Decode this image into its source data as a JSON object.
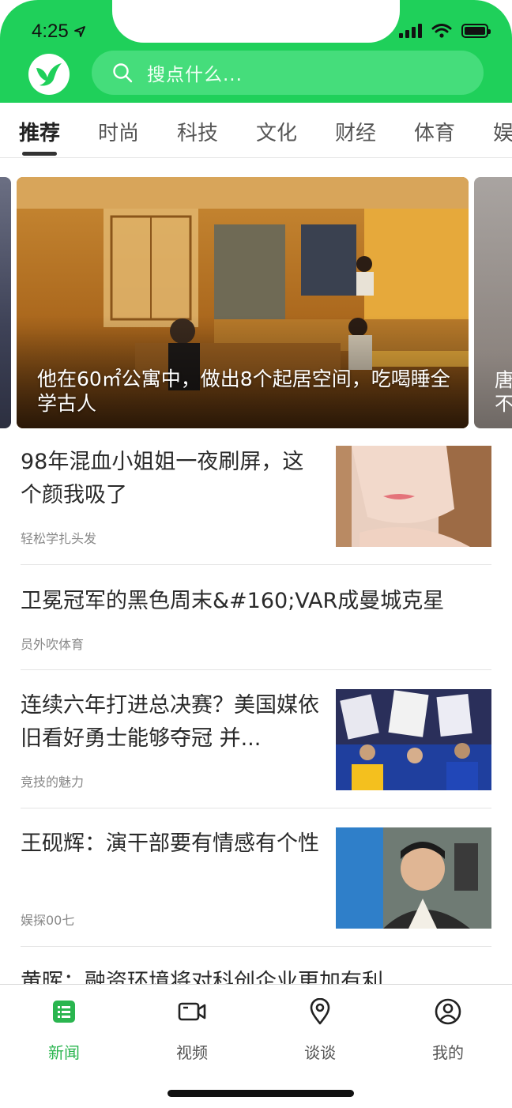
{
  "status_bar": {
    "time": "4:25"
  },
  "search": {
    "placeholder": "搜点什么..."
  },
  "tabs": [
    {
      "label": "推荐",
      "active": true
    },
    {
      "label": "时尚"
    },
    {
      "label": "科技"
    },
    {
      "label": "文化"
    },
    {
      "label": "财经"
    },
    {
      "label": "体育"
    },
    {
      "label": "娱"
    }
  ],
  "banner": {
    "caption": "他在60㎡公寓中，做出8个起居空间，吃喝睡全学古人",
    "next_caption_partial": "唐\n不"
  },
  "news": [
    {
      "title": "98年混血小姐姐一夜刷屏，这个颜我吸了",
      "source": "轻松学扎头发",
      "thumb": "portrait-woman"
    },
    {
      "title": "卫冕冠军的黑色周末&#160;VAR成曼城克星",
      "source": "员外吹体育"
    },
    {
      "title": "连续六年打进总决赛？美国媒依旧看好勇士能够夺冠 并...",
      "source": "竞技的魅力",
      "thumb": "basketball-fans"
    },
    {
      "title": "王砚辉：演干部要有情感有个性",
      "source": "娱探00七",
      "thumb": "actor-kitchen"
    },
    {
      "title": "黄晖：融资环境将对科创企业更加有利",
      "source": ""
    }
  ],
  "bottom_nav": [
    {
      "label": "新闻",
      "icon": "list-icon",
      "active": true
    },
    {
      "label": "视频",
      "icon": "video-camera-icon"
    },
    {
      "label": "谈谈",
      "icon": "location-pin-icon"
    },
    {
      "label": "我的",
      "icon": "user-icon"
    }
  ],
  "colors": {
    "brand": "#1fd05a",
    "active_nav": "#2ab54f"
  }
}
